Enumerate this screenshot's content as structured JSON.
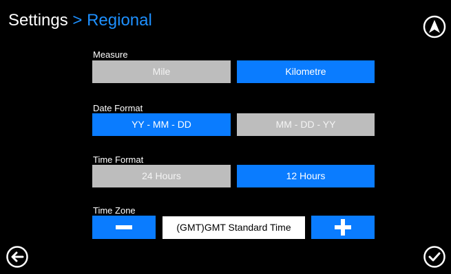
{
  "header": {
    "title": "Settings",
    "separator": ">",
    "subtitle": "Regional"
  },
  "icons": {
    "top_right": "navigation-icon",
    "bottom_left": "back-icon",
    "bottom_right": "confirm-icon"
  },
  "colors": {
    "accent": "#0a7cff",
    "inactive": "#bdbdbd",
    "background": "#000000"
  },
  "measure": {
    "label": "Measure",
    "options": [
      "Mile",
      "Kilometre"
    ],
    "selected": "Kilometre"
  },
  "date_format": {
    "label": "Date Format",
    "options": [
      "YY - MM - DD",
      "MM - DD - YY"
    ],
    "selected": "YY - MM - DD"
  },
  "time_format": {
    "label": "Time Format",
    "options": [
      "24 Hours",
      "12 Hours"
    ],
    "selected": "12 Hours"
  },
  "time_zone": {
    "label": "Time Zone",
    "value": "(GMT)GMT Standard Time"
  }
}
